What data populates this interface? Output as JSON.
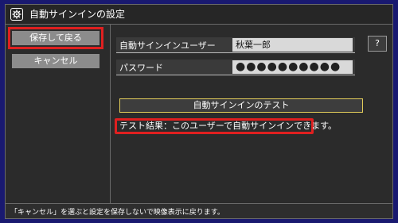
{
  "window": {
    "title": "自動サインインの設定",
    "icon": "gear-icon"
  },
  "sidebar": {
    "save_label": "保存して戻る",
    "cancel_label": "キャンセル"
  },
  "fields": {
    "user_label": "自動サインインユーザー",
    "user_value": "秋葉一郎",
    "password_label": "パスワード",
    "password_value": "●●●●●●●●●●"
  },
  "help_label": "?",
  "test_button_label": "自動サインインのテスト",
  "result_text": "テスト結果：このユーザーで自動サインインできます。",
  "status_text": "「キャンセル」を選ぶと設定を保存しないで映像表示に戻ります。",
  "colors": {
    "highlight": "#e02020",
    "test_border": "#e3cd5a",
    "background": "#191970"
  }
}
